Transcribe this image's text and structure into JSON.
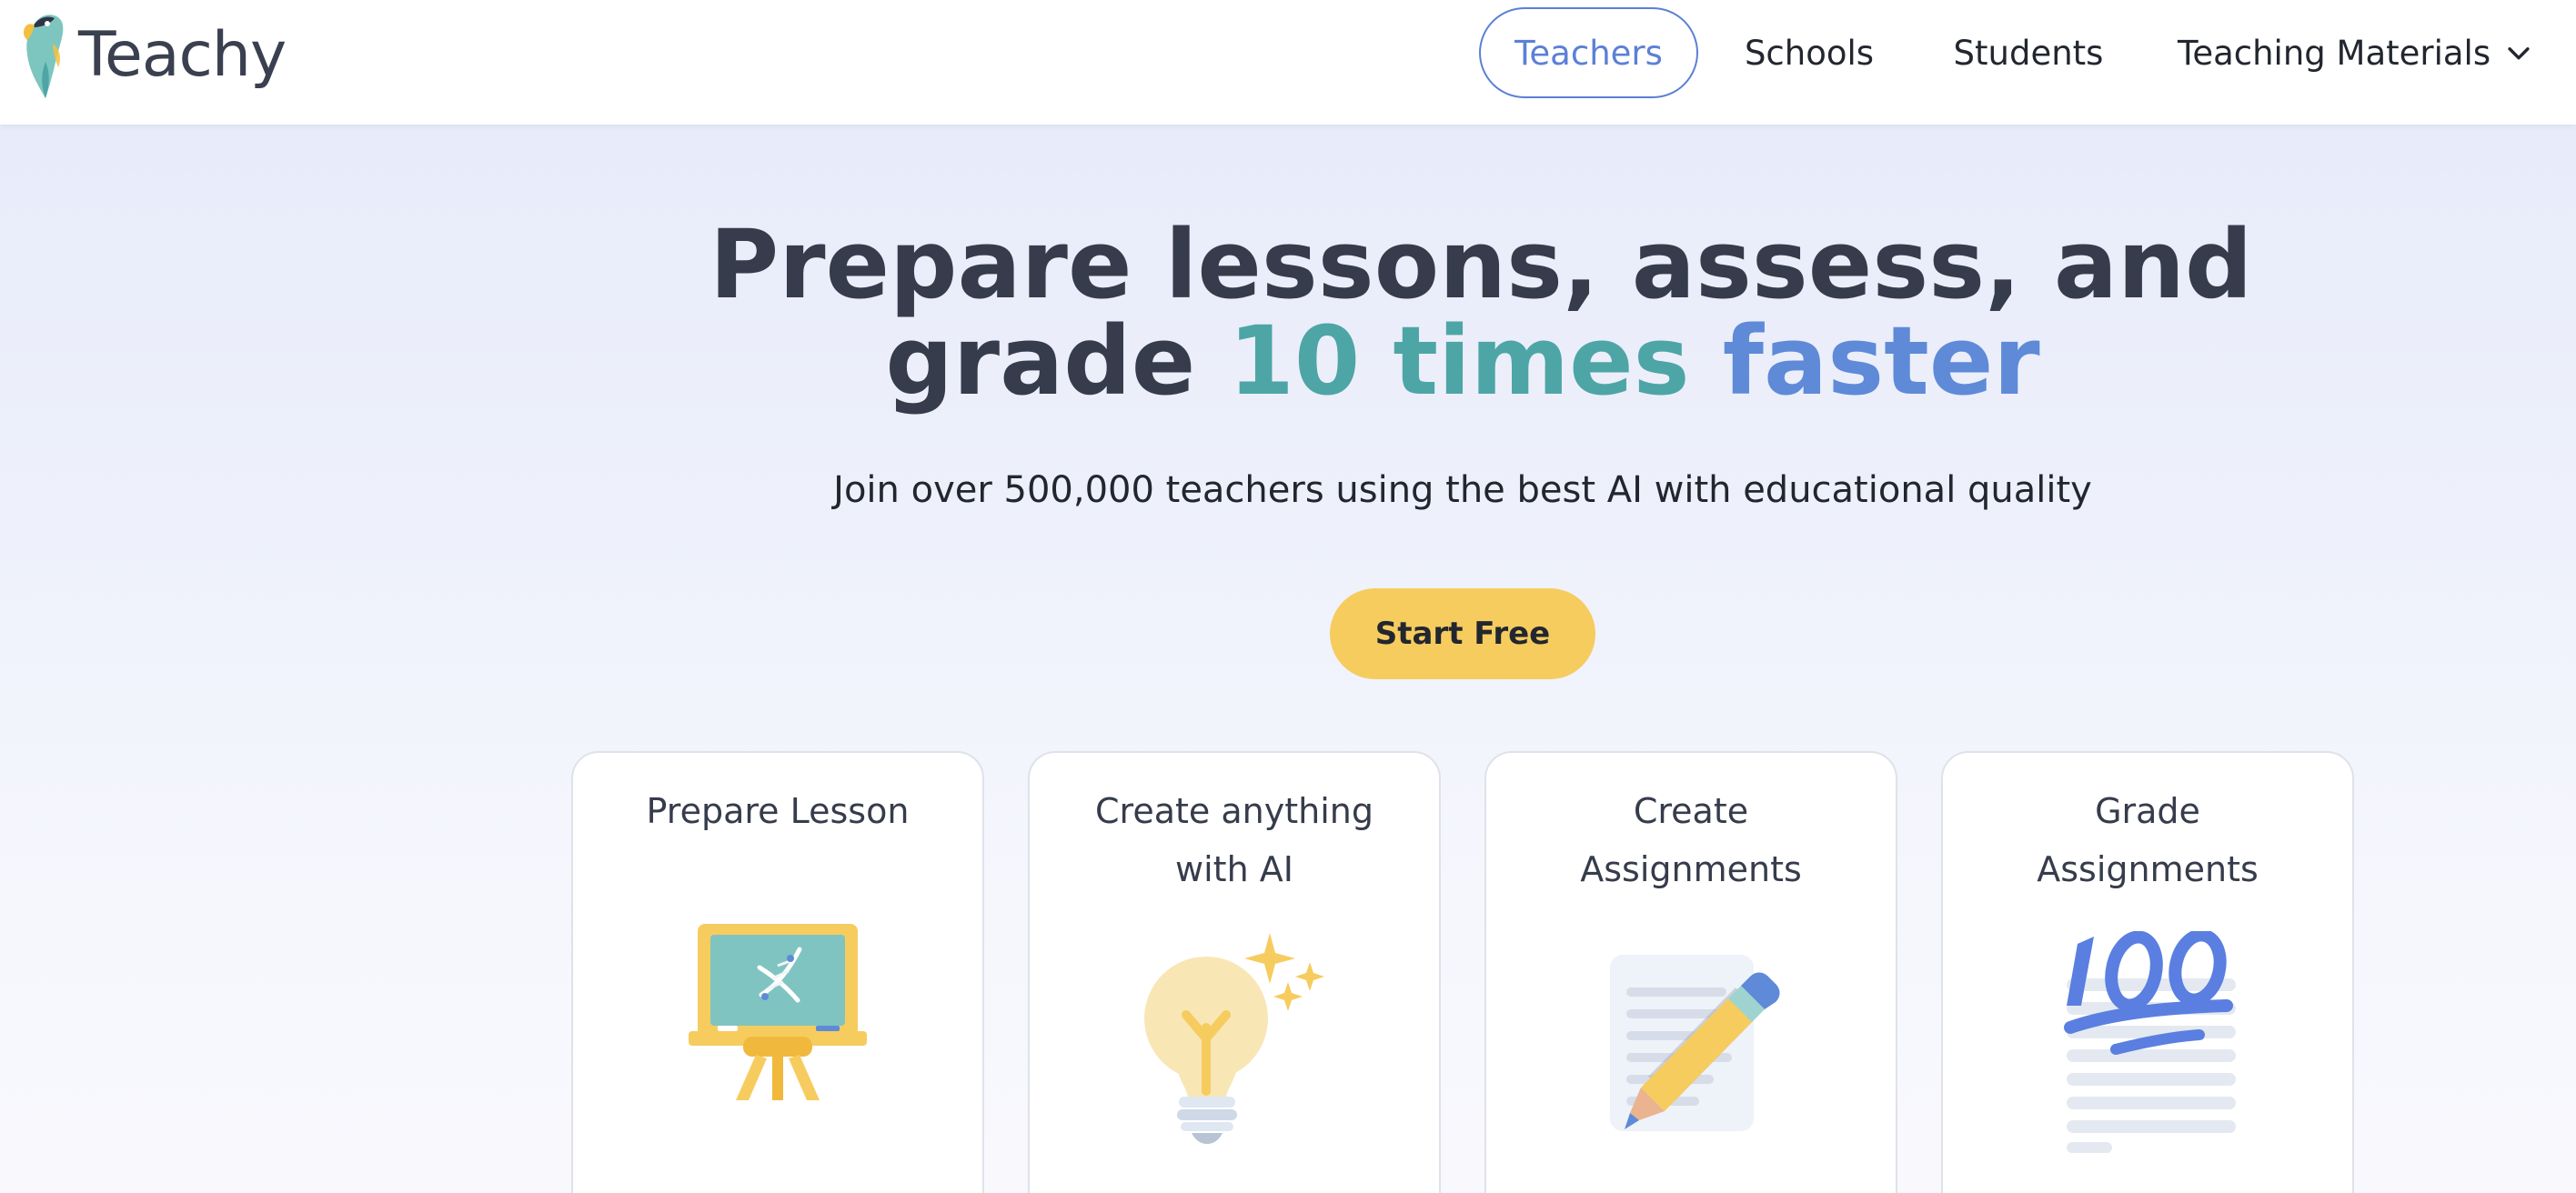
{
  "header": {
    "brand": "Teachy",
    "nav": [
      {
        "label": "Teachers",
        "active": true
      },
      {
        "label": "Schools"
      },
      {
        "label": "Students"
      },
      {
        "label": "Teaching Materials"
      }
    ]
  },
  "hero": {
    "headline_line1": "Prepare lessons, assess, and",
    "headline_line2_prefix": "grade ",
    "headline_line2_accent1": "10 times",
    "headline_line2_accent2": " faster",
    "subtitle": "Join over 500,000 teachers using the best AI with educational quality",
    "cta_label": "Start Free"
  },
  "cards": [
    {
      "title": "Prepare Lesson",
      "icon": "chalkboard-icon"
    },
    {
      "title": "Create anything with AI",
      "icon": "lightbulb-icon"
    },
    {
      "title": "Create Assignments",
      "icon": "pencil-document-icon"
    },
    {
      "title": "Grade Assignments",
      "icon": "hundred-score-icon"
    }
  ],
  "colors": {
    "brand_blue": "#5b80d6",
    "accent_teal": "#4ea5a6",
    "accent_blue": "#5e8ad8",
    "cta_yellow": "#f6cc5f",
    "text_dark": "#363c4b"
  }
}
